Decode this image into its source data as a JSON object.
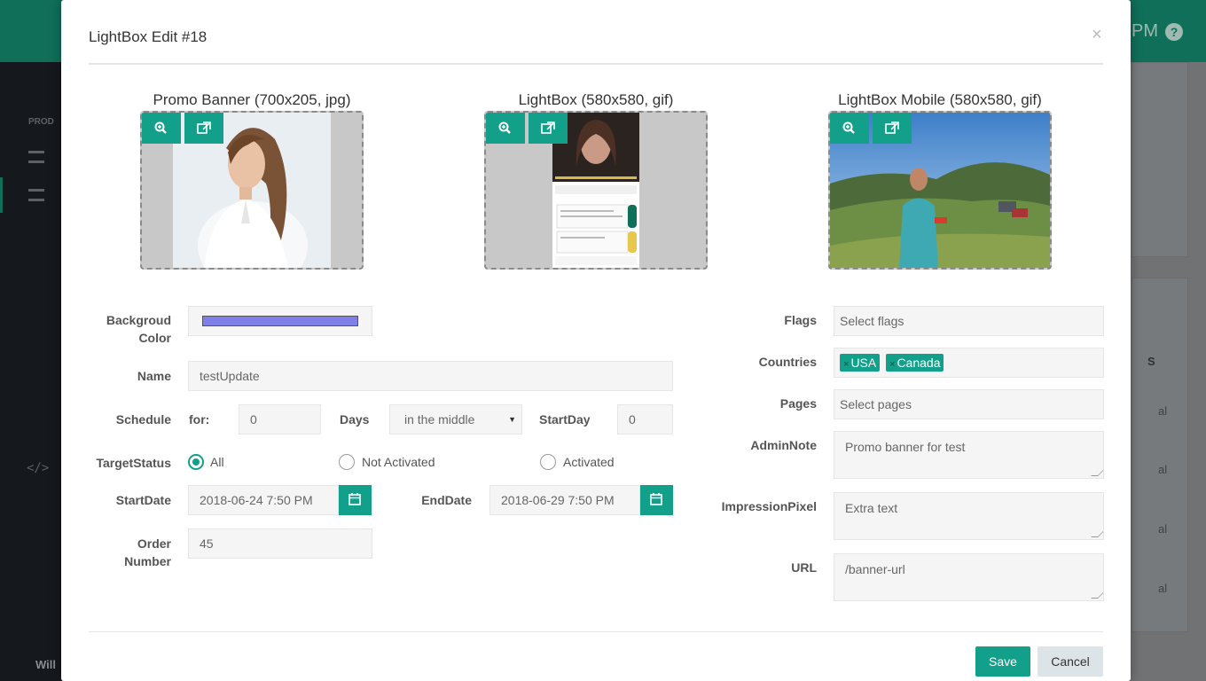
{
  "background": {
    "topbar_time_suffix": "PM",
    "help": "?",
    "sidebar_section": "PROD",
    "sidebar_code_icon": "</>",
    "user_name": "Will",
    "table_cells": [
      "al",
      "al",
      "al",
      "al"
    ],
    "sort_label": "S"
  },
  "modal": {
    "title": "LightBox Edit #18",
    "close": "×",
    "previews": [
      {
        "caption": "Promo Banner (700x205, jpg)",
        "zoom_icon": "zoom-in-icon",
        "open_icon": "external-link-icon"
      },
      {
        "caption": "LightBox (580x580, gif)",
        "zoom_icon": "zoom-in-icon",
        "open_icon": "external-link-icon"
      },
      {
        "caption": "LightBox Mobile (580x580, gif)",
        "zoom_icon": "zoom-in-icon",
        "open_icon": "external-link-icon"
      }
    ],
    "form": {
      "bg_color_label_1": "Backgroud",
      "bg_color_label_2": "Color",
      "bg_color_value": "#7f7fe8",
      "name_label": "Name",
      "name_value": "testUpdate",
      "schedule_label": "Schedule",
      "for_label": "for:",
      "for_value": "0",
      "days_label": "Days",
      "position_value": "in the middle",
      "startday_label": "StartDay",
      "startday_value": "0",
      "target_label": "TargetStatus",
      "target_options": [
        "All",
        "Not Activated",
        "Activated"
      ],
      "target_selected": "All",
      "startdate_label": "StartDate",
      "startdate_value": "2018-06-24 7:50 PM",
      "enddate_label": "EndDate",
      "enddate_value": "2018-06-29 7:50 PM",
      "order_label_1": "Order",
      "order_label_2": "Number",
      "order_value": "45",
      "flags_label": "Flags",
      "flags_placeholder": "Select flags",
      "countries_label": "Countries",
      "countries": [
        "USA",
        "Canada"
      ],
      "pages_label": "Pages",
      "pages_placeholder": "Select pages",
      "adminnote_label": "AdminNote",
      "adminnote_value": "Promo banner for test",
      "pixel_label": "ImpressionPixel",
      "pixel_value": "Extra text",
      "url_label": "URL",
      "url_value": "/banner-url"
    },
    "footer": {
      "save": "Save",
      "cancel": "Cancel"
    }
  },
  "colors": {
    "accent": "#13a08a",
    "topbar": "#0f6f59",
    "sidebar": "#15191d"
  }
}
